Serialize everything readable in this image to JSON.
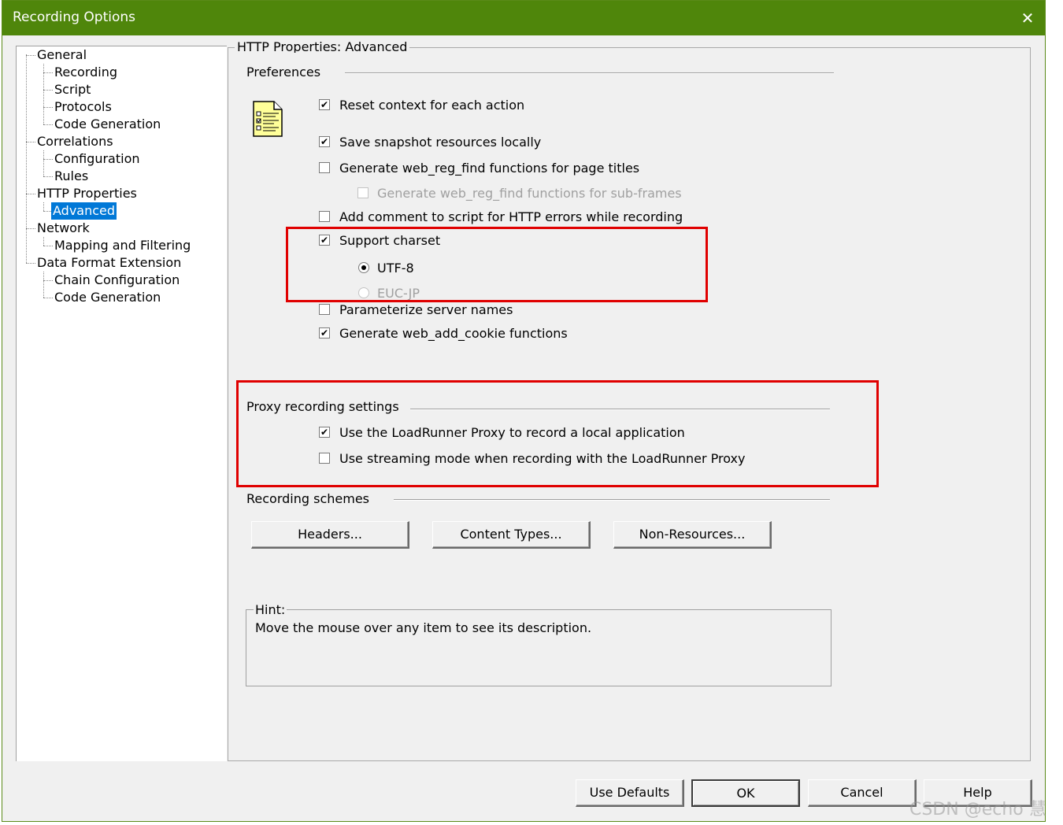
{
  "window": {
    "title": "Recording Options",
    "close_glyph": "✕"
  },
  "tree": {
    "items": [
      {
        "label": "General"
      },
      {
        "label": "Recording"
      },
      {
        "label": "Script"
      },
      {
        "label": "Protocols"
      },
      {
        "label": "Code Generation"
      },
      {
        "label": "Correlations"
      },
      {
        "label": "Configuration"
      },
      {
        "label": "Rules"
      },
      {
        "label": "HTTP Properties"
      },
      {
        "label": "Advanced",
        "selected": true
      },
      {
        "label": "Network"
      },
      {
        "label": "Mapping and Filtering"
      },
      {
        "label": "Data Format Extension"
      },
      {
        "label": "Chain Configuration"
      },
      {
        "label": "Code Generation"
      }
    ]
  },
  "panel": {
    "title": "HTTP Properties: Advanced",
    "preferences": {
      "heading": "Preferences",
      "icon": "document-checklist-icon",
      "options": [
        {
          "label": "Reset context for each action",
          "checked": true
        },
        {
          "label": "Save snapshot resources locally",
          "checked": true
        },
        {
          "label": "Generate web_reg_find functions for page titles",
          "checked": false
        },
        {
          "label": "Generate web_reg_find functions for sub-frames",
          "checked": false,
          "disabled": true
        },
        {
          "label": "Add comment to script for HTTP errors while recording",
          "checked": false
        },
        {
          "label": "Support charset",
          "checked": true
        },
        {
          "label": "Parameterize server names",
          "checked": false
        },
        {
          "label": "Generate web_add_cookie functions",
          "checked": true
        }
      ],
      "charset": [
        {
          "label": "UTF-8",
          "selected": true
        },
        {
          "label": "EUC-JP",
          "selected": false,
          "disabled": true
        }
      ]
    },
    "proxy": {
      "heading": "Proxy recording settings",
      "options": [
        {
          "label": "Use the LoadRunner Proxy to record a local application",
          "checked": true
        },
        {
          "label": "Use streaming mode when recording with the LoadRunner Proxy",
          "checked": false
        }
      ]
    },
    "schemes": {
      "heading": "Recording schemes",
      "buttons": [
        "Headers...",
        "Content Types...",
        "Non-Resources..."
      ]
    },
    "hint": {
      "label": "Hint:",
      "text": "Move the mouse over any item to see its description."
    }
  },
  "footer": {
    "use_defaults": "Use Defaults",
    "ok": "OK",
    "cancel": "Cancel",
    "help": "Help"
  },
  "watermark": "CSDN @echo 慧",
  "colors": {
    "titlebar": "#4f860b",
    "selection": "#0078d7",
    "highlight_box": "#e00000"
  }
}
